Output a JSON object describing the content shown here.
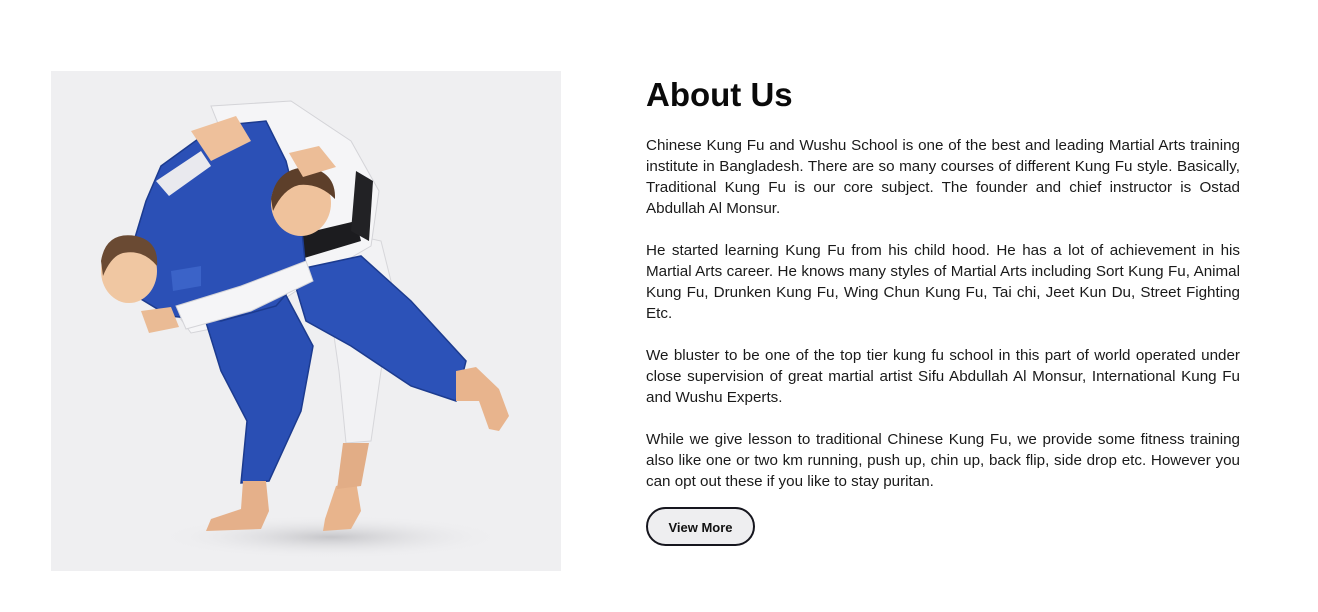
{
  "about": {
    "title": "About Us",
    "paragraphs": [
      "Chinese Kung Fu and Wushu School is one of the best and leading Martial Arts training institute in Bangladesh. There are so many courses of different Kung Fu style. Basically, Traditional Kung Fu is our core subject. The founder and chief instructor is Ostad Abdullah Al Monsur.",
      "He started learning Kung Fu from his child hood. He has a lot of achievement in his Martial Arts career. He knows many styles of Martial Arts including Sort Kung Fu, Animal Kung Fu, Drunken Kung Fu, Wing Chun Kung Fu, Tai chi, Jeet Kun Du, Street Fighting Etc.",
      "We bluster to be one of the top tier kung fu school in this part of world operated under close supervision of great martial artist Sifu Abdullah Al Monsur, International Kung Fu and Wushu Experts.",
      "While we give lesson to traditional Chinese Kung Fu, we provide some fitness training also like one or two km running, push up, chin up, back flip, side drop etc. However you can opt out these if you like to stay puritan."
    ],
    "button_label": "View More"
  },
  "image": {
    "subject": "two martial artists in blue and white gi performing a throw",
    "background_color": "#efeff1",
    "blue_gi_color": "#2a4fb4",
    "white_gi_color": "#f4f4f6"
  }
}
